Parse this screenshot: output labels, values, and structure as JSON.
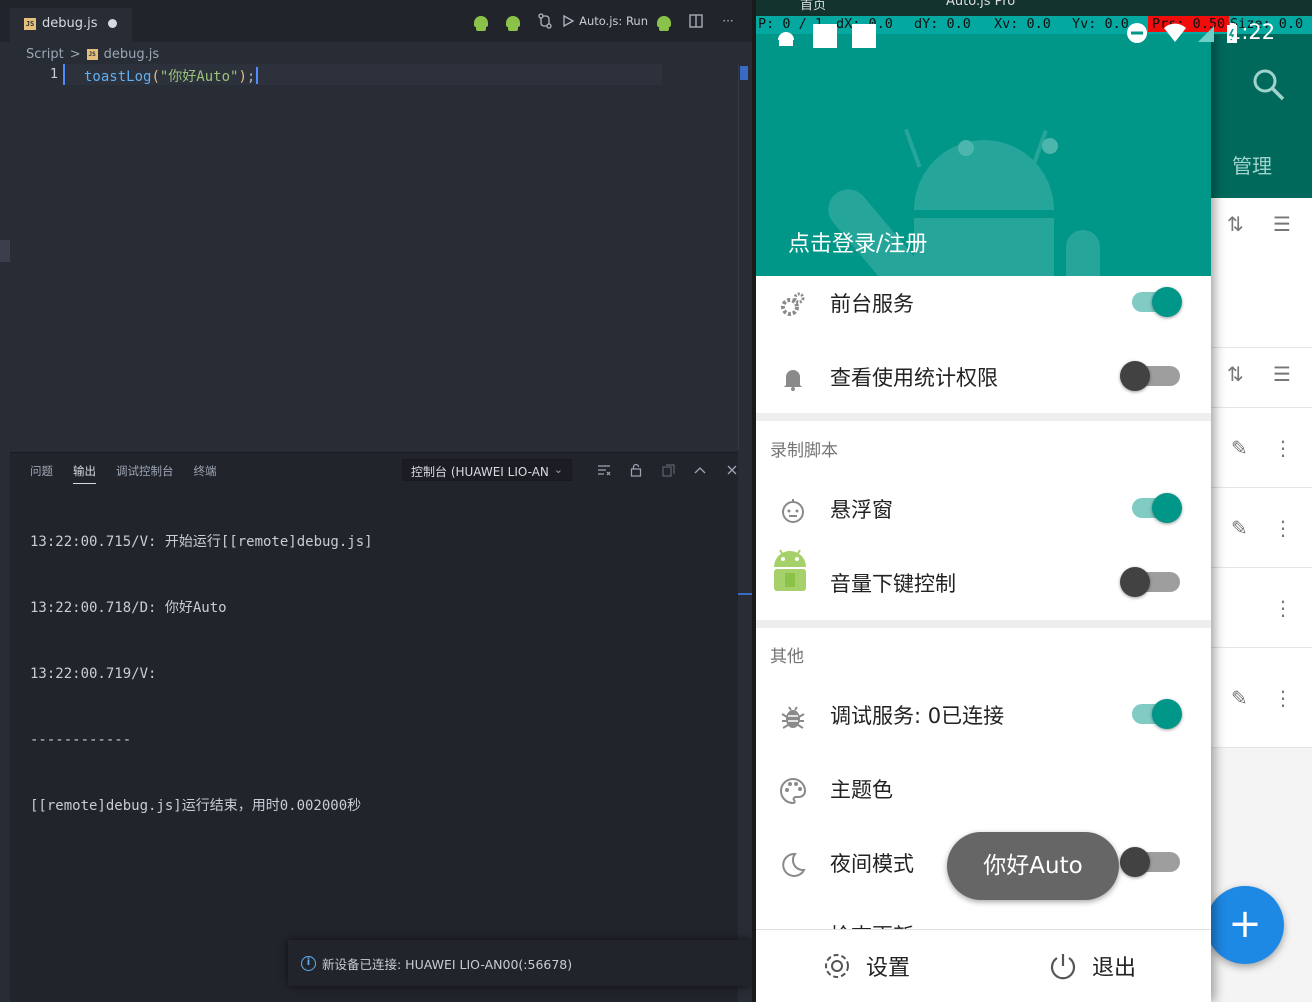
{
  "vscode": {
    "tab": {
      "filename": "debug.js",
      "js_badge": "JS"
    },
    "toolbar": {
      "run_label": "Auto.js: Run",
      "more": "···"
    },
    "breadcrumb": {
      "root": "Script",
      "sep": ">",
      "file": "debug.js"
    },
    "editor": {
      "line_number": "1",
      "code": {
        "fn": "toastLog",
        "open": "(",
        "str": "\"你好Auto\"",
        "close": ")",
        "semi": ";"
      }
    },
    "panel": {
      "tabs": [
        "问题",
        "输出",
        "调试控制台",
        "终端"
      ],
      "active_tab": "输出",
      "channel": "控制台 (HUAWEI LIO-AN",
      "output_lines": [
        "13:22:00.715/V: 开始运行[[remote]debug.js]",
        "13:22:00.718/D: 你好Auto",
        "13:22:00.719/V:",
        "------------",
        "[[remote]debug.js]运行结束，用时0.002000秒"
      ]
    },
    "notification": {
      "text": "新设备已连接: HUAWEI LIO-AN00(:56678)"
    }
  },
  "phone": {
    "overlay": {
      "p": "P: 0 / 1",
      "dx": "dX: 0.0",
      "dy": "dY: 0.0",
      "xv": "Xv: 0.0",
      "yv": "Yv: 0.0",
      "prs": "Prs: 0.50",
      "size": "Size: 0.0"
    },
    "top_strip": {
      "home": "首页",
      "window": "Auto.js Pro"
    },
    "clock": "1:22",
    "drawer": {
      "login": "点击登录/注册",
      "items": [
        {
          "label": "前台服务",
          "icon": "gears-icon",
          "switch": "on"
        },
        {
          "label": "查看使用统计权限",
          "icon": "bell-icon",
          "switch": "off"
        }
      ],
      "section_record": "录制脚本",
      "record_items": [
        {
          "label": "悬浮窗",
          "icon": "face-icon",
          "switch": "on"
        },
        {
          "label": "音量下键控制",
          "icon": "android-icon",
          "switch": "off"
        }
      ],
      "section_other": "其他",
      "other_items": [
        {
          "label": "调试服务: 0已连接",
          "icon": "bug-icon",
          "switch": "on"
        },
        {
          "label": "主题色",
          "icon": "palette-icon"
        },
        {
          "label": "夜间模式",
          "icon": "moon-icon",
          "switch": "off"
        }
      ],
      "cut_item": "检查更新",
      "bottom": {
        "settings": "设置",
        "exit": "退出"
      }
    },
    "app": {
      "tab_label": "管理",
      "fab": "+"
    },
    "toast": "你好Auto",
    "colors": {
      "teal": "#009688",
      "teal_dark": "#00695c",
      "fab": "#1e88e5"
    }
  }
}
